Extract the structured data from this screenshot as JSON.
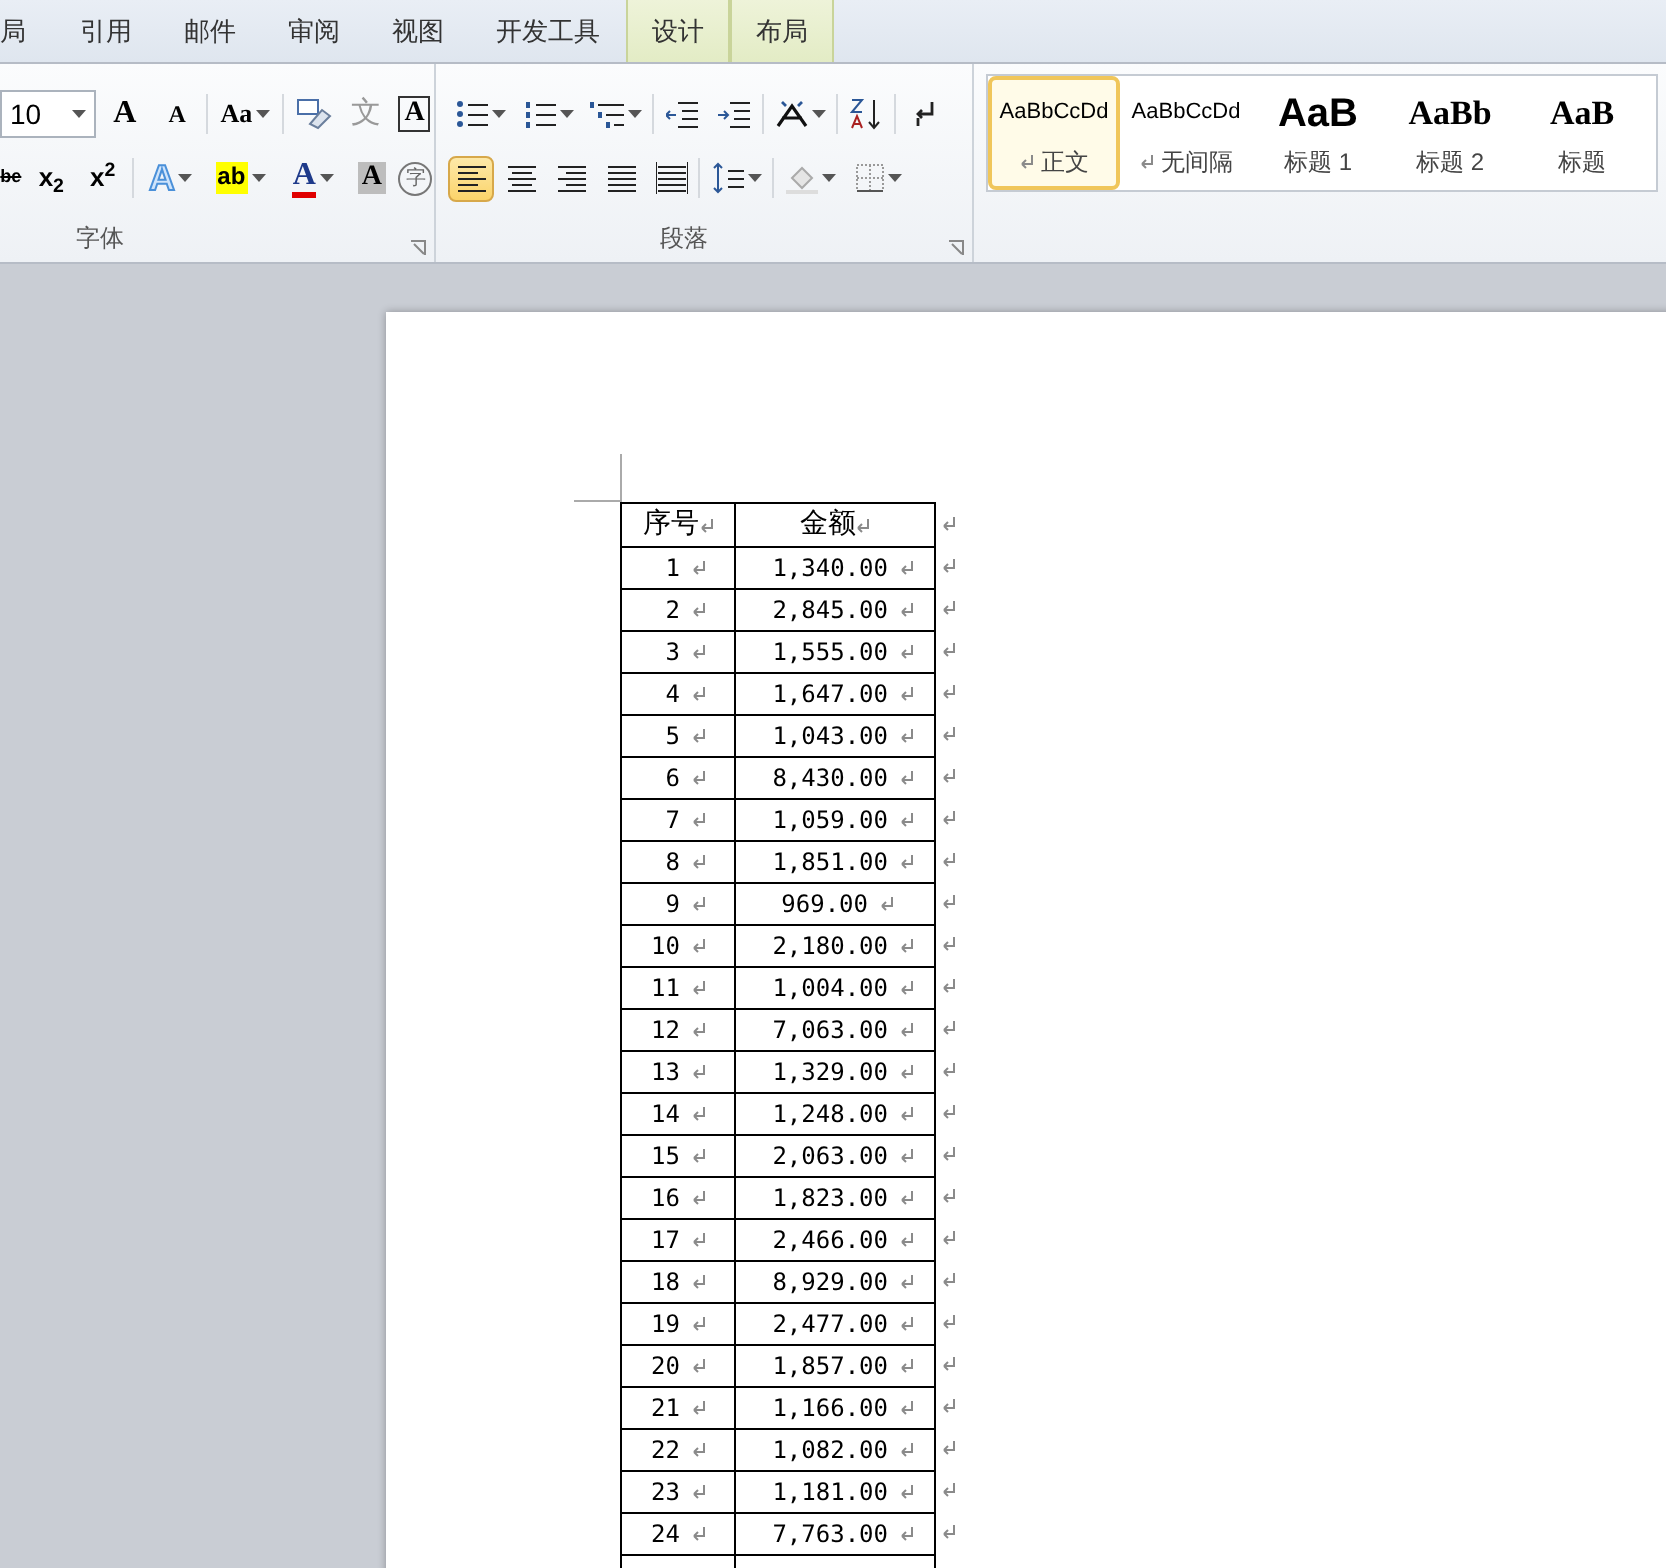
{
  "tabs": [
    {
      "label": "局",
      "contextual": false
    },
    {
      "label": "引用",
      "contextual": false
    },
    {
      "label": "邮件",
      "contextual": false
    },
    {
      "label": "审阅",
      "contextual": false
    },
    {
      "label": "视图",
      "contextual": false
    },
    {
      "label": "开发工具",
      "contextual": false
    },
    {
      "label": "设计",
      "contextual": true
    },
    {
      "label": "布局",
      "contextual": true
    }
  ],
  "font_group": {
    "label": "字体",
    "font_size": "10",
    "grow": "A",
    "shrink": "A",
    "change_case": "Aa",
    "phonetic": "文",
    "char_border": "A",
    "strike": "be",
    "subscript": "x$_{2}$",
    "superscript": "x$^{2}$",
    "text_effects": "A",
    "highlight": "ab",
    "font_color": "A",
    "char_shading": "A",
    "enclosed": "字"
  },
  "paragraph_group": {
    "label": "段落",
    "alignment": [
      {
        "kind": "left",
        "selected": true
      },
      {
        "kind": "center",
        "selected": false
      },
      {
        "kind": "right",
        "selected": false
      },
      {
        "kind": "justify",
        "selected": false
      },
      {
        "kind": "distributed",
        "selected": false
      }
    ]
  },
  "styles": [
    {
      "preview": "AaBbCcDd",
      "name": "正文",
      "kind": "body",
      "selected": true
    },
    {
      "preview": "AaBbCcDd",
      "name": "无间隔",
      "kind": "body",
      "selected": false
    },
    {
      "preview": "AaB",
      "name": "标题 1",
      "kind": "heading1",
      "selected": false
    },
    {
      "preview": "AaBb",
      "name": "标题 2",
      "kind": "heading2",
      "selected": false
    },
    {
      "preview": "AaB",
      "name": "标题",
      "kind": "heading2",
      "selected": false
    }
  ],
  "table": {
    "columns": [
      "序号",
      "金额"
    ],
    "rows": [
      [
        "1",
        "1,340.00"
      ],
      [
        "2",
        "2,845.00"
      ],
      [
        "3",
        "1,555.00"
      ],
      [
        "4",
        "1,647.00"
      ],
      [
        "5",
        "1,043.00"
      ],
      [
        "6",
        "8,430.00"
      ],
      [
        "7",
        "1,059.00"
      ],
      [
        "8",
        "1,851.00"
      ],
      [
        "9",
        "969.00"
      ],
      [
        "10",
        "2,180.00"
      ],
      [
        "11",
        "1,004.00"
      ],
      [
        "12",
        "7,063.00"
      ],
      [
        "13",
        "1,329.00"
      ],
      [
        "14",
        "1,248.00"
      ],
      [
        "15",
        "2,063.00"
      ],
      [
        "16",
        "1,823.00"
      ],
      [
        "17",
        "2,466.00"
      ],
      [
        "18",
        "8,929.00"
      ],
      [
        "19",
        "2,477.00"
      ],
      [
        "20",
        "1,857.00"
      ],
      [
        "21",
        "1,166.00"
      ],
      [
        "22",
        "1,082.00"
      ],
      [
        "23",
        "1,181.00"
      ],
      [
        "24",
        "7,763.00"
      ]
    ]
  }
}
